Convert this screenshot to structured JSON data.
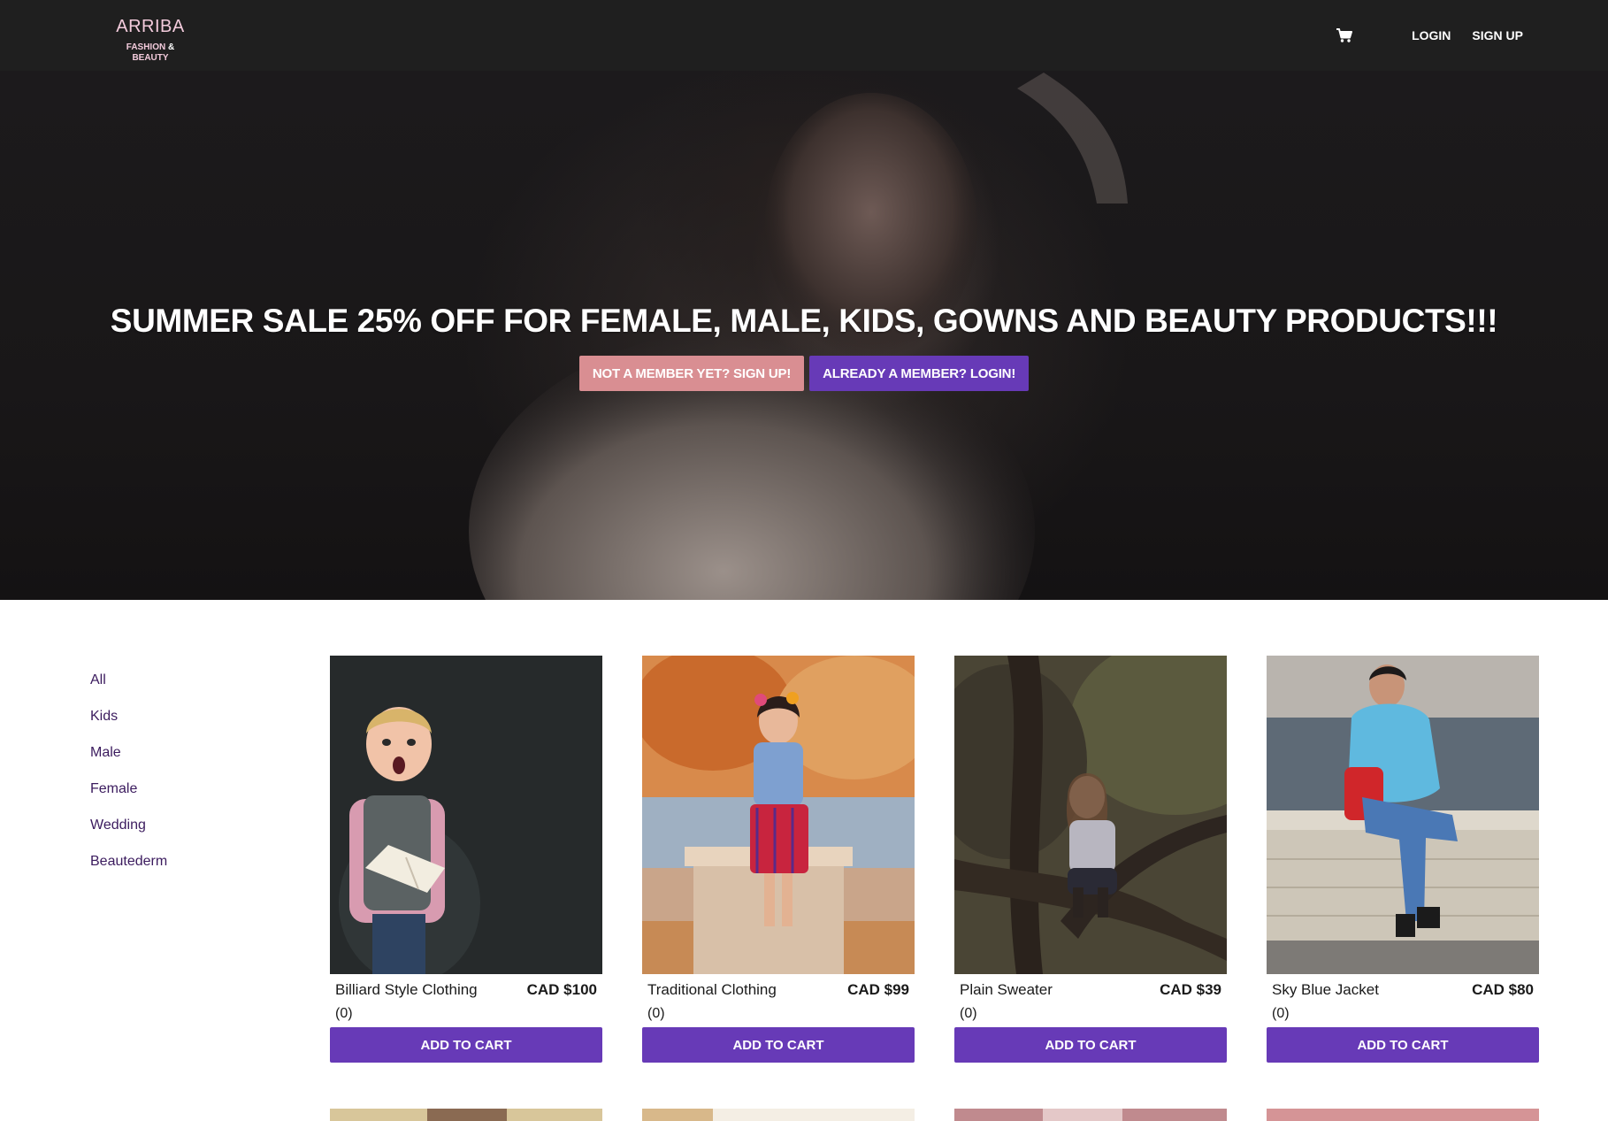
{
  "brand": {
    "name": "ARRIBA",
    "tag_left": "FASHION",
    "tag_amp": "&",
    "tag_right": "BEAUTY"
  },
  "nav": {
    "cart_icon": "shopping-cart-icon",
    "login": "LOGIN",
    "signup": "SIGN UP"
  },
  "hero": {
    "title": "SUMMER SALE 25% OFF FOR FEMALE, MALE, KIDS, GOWNS AND BEAUTY PRODUCTS!!!",
    "signup_button": "NOT A MEMBER YET? SIGN UP!",
    "login_button": "ALREADY A MEMBER? LOGIN!"
  },
  "categories": [
    "All",
    "Kids",
    "Male",
    "Female",
    "Wedding",
    "Beautederm"
  ],
  "products": [
    {
      "name": "Billiard Style Clothing",
      "price": "CAD $100",
      "reviews": "(0)",
      "button": "ADD TO CART"
    },
    {
      "name": "Traditional Clothing",
      "price": "CAD $99",
      "reviews": "(0)",
      "button": "ADD TO CART"
    },
    {
      "name": "Plain Sweater",
      "price": "CAD $39",
      "reviews": "(0)",
      "button": "ADD TO CART"
    },
    {
      "name": "Sky Blue Jacket",
      "price": "CAD $80",
      "reviews": "(0)",
      "button": "ADD TO CART"
    }
  ],
  "colors": {
    "navbar": "#1f1f1f",
    "brand_pink": "#f3cbdc",
    "accent_purple": "#673ab7",
    "accent_pink": "#d98e92",
    "category_text": "#3b1b5e"
  }
}
